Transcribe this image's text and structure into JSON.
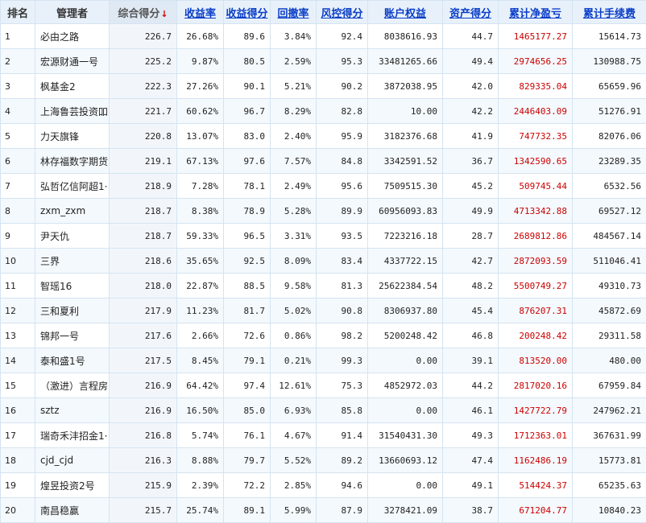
{
  "colors": {
    "accent_link": "#0b3ec8",
    "loss_red": "#cc0000",
    "sort_arrow": "#d40000"
  },
  "columns": {
    "rank": "排名",
    "manager": "管理者",
    "composite": "综合得分",
    "sort_arrow": "↓",
    "return_rate": "收益率",
    "return_score": "收益得分",
    "drawdown": "回撤率",
    "risk_score": "风控得分",
    "equity": "账户权益",
    "asset_score": "资产得分",
    "net_pnl": "累计净盈亏",
    "fees": "累计手续费"
  },
  "rows": [
    {
      "rank": "1",
      "manager": "必由之路",
      "composite": "226.7",
      "return_rate": "26.68%",
      "return_score": "89.6",
      "drawdown": "3.84%",
      "risk_score": "92.4",
      "equity": "8038616.93",
      "asset_score": "44.7",
      "net_pnl": "1465177.27",
      "fees": "15614.73"
    },
    {
      "rank": "2",
      "manager": "宏源财通一号",
      "composite": "225.2",
      "return_rate": "9.87%",
      "return_score": "80.5",
      "drawdown": "2.59%",
      "risk_score": "95.3",
      "equity": "33481265.66",
      "asset_score": "49.4",
      "net_pnl": "2974656.25",
      "fees": "130988.75"
    },
    {
      "rank": "3",
      "manager": "枫基金2",
      "composite": "222.3",
      "return_rate": "27.26%",
      "return_score": "90.1",
      "drawdown": "5.21%",
      "risk_score": "90.2",
      "equity": "3872038.95",
      "asset_score": "42.0",
      "net_pnl": "829335.04",
      "fees": "65659.96"
    },
    {
      "rank": "4",
      "manager": "上海鲁芸投资吅",
      "composite": "221.7",
      "return_rate": "60.62%",
      "return_score": "96.7",
      "drawdown": "8.29%",
      "risk_score": "82.8",
      "equity": "10.00",
      "asset_score": "42.2",
      "net_pnl": "2446403.09",
      "fees": "51276.91"
    },
    {
      "rank": "5",
      "manager": "力天旗锋",
      "composite": "220.8",
      "return_rate": "13.07%",
      "return_score": "83.0",
      "drawdown": "2.40%",
      "risk_score": "95.9",
      "equity": "3182376.68",
      "asset_score": "41.9",
      "net_pnl": "747732.35",
      "fees": "82076.06"
    },
    {
      "rank": "6",
      "manager": "林存福数字期货",
      "composite": "219.1",
      "return_rate": "67.13%",
      "return_score": "97.6",
      "drawdown": "7.57%",
      "risk_score": "84.8",
      "equity": "3342591.52",
      "asset_score": "36.7",
      "net_pnl": "1342590.65",
      "fees": "23289.35"
    },
    {
      "rank": "7",
      "manager": "弘哲亿信阿超1·",
      "composite": "218.9",
      "return_rate": "7.28%",
      "return_score": "78.1",
      "drawdown": "2.49%",
      "risk_score": "95.6",
      "equity": "7509515.30",
      "asset_score": "45.2",
      "net_pnl": "509745.44",
      "fees": "6532.56"
    },
    {
      "rank": "8",
      "manager": "zxm_zxm",
      "composite": "218.7",
      "return_rate": "8.38%",
      "return_score": "78.9",
      "drawdown": "5.28%",
      "risk_score": "89.9",
      "equity": "60956093.83",
      "asset_score": "49.9",
      "net_pnl": "4713342.88",
      "fees": "69527.12"
    },
    {
      "rank": "9",
      "manager": "尹天仇",
      "composite": "218.7",
      "return_rate": "59.33%",
      "return_score": "96.5",
      "drawdown": "3.31%",
      "risk_score": "93.5",
      "equity": "7223216.18",
      "asset_score": "28.7",
      "net_pnl": "2689812.86",
      "fees": "484567.14"
    },
    {
      "rank": "10",
      "manager": "三界",
      "composite": "218.6",
      "return_rate": "35.65%",
      "return_score": "92.5",
      "drawdown": "8.09%",
      "risk_score": "83.4",
      "equity": "4337722.15",
      "asset_score": "42.7",
      "net_pnl": "2872093.59",
      "fees": "511046.41"
    },
    {
      "rank": "11",
      "manager": "智瑶16",
      "composite": "218.0",
      "return_rate": "22.87%",
      "return_score": "88.5",
      "drawdown": "9.58%",
      "risk_score": "81.3",
      "equity": "25622384.54",
      "asset_score": "48.2",
      "net_pnl": "5500749.27",
      "fees": "49310.73"
    },
    {
      "rank": "12",
      "manager": "三和夏利",
      "composite": "217.9",
      "return_rate": "11.23%",
      "return_score": "81.7",
      "drawdown": "5.02%",
      "risk_score": "90.8",
      "equity": "8306937.80",
      "asset_score": "45.4",
      "net_pnl": "876207.31",
      "fees": "45872.69"
    },
    {
      "rank": "13",
      "manager": "锦邦一号",
      "composite": "217.6",
      "return_rate": "2.66%",
      "return_score": "72.6",
      "drawdown": "0.86%",
      "risk_score": "98.2",
      "equity": "5200248.42",
      "asset_score": "46.8",
      "net_pnl": "200248.42",
      "fees": "29311.58"
    },
    {
      "rank": "14",
      "manager": "泰和盛1号",
      "composite": "217.5",
      "return_rate": "8.45%",
      "return_score": "79.1",
      "drawdown": "0.21%",
      "risk_score": "99.3",
      "equity": "0.00",
      "asset_score": "39.1",
      "net_pnl": "813520.00",
      "fees": "480.00"
    },
    {
      "rank": "15",
      "manager": "（激进）言程房",
      "composite": "216.9",
      "return_rate": "64.42%",
      "return_score": "97.4",
      "drawdown": "12.61%",
      "risk_score": "75.3",
      "equity": "4852972.03",
      "asset_score": "44.2",
      "net_pnl": "2817020.16",
      "fees": "67959.84"
    },
    {
      "rank": "16",
      "manager": "sztz",
      "composite": "216.9",
      "return_rate": "16.50%",
      "return_score": "85.0",
      "drawdown": "6.93%",
      "risk_score": "85.8",
      "equity": "0.00",
      "asset_score": "46.1",
      "net_pnl": "1427722.79",
      "fees": "247962.21"
    },
    {
      "rank": "17",
      "manager": "瑞奇禾沣招金1·",
      "composite": "216.8",
      "return_rate": "5.74%",
      "return_score": "76.1",
      "drawdown": "4.67%",
      "risk_score": "91.4",
      "equity": "31540431.30",
      "asset_score": "49.3",
      "net_pnl": "1712363.01",
      "fees": "367631.99"
    },
    {
      "rank": "18",
      "manager": "cjd_cjd",
      "composite": "216.3",
      "return_rate": "8.88%",
      "return_score": "79.7",
      "drawdown": "5.52%",
      "risk_score": "89.2",
      "equity": "13660693.12",
      "asset_score": "47.4",
      "net_pnl": "1162486.19",
      "fees": "15773.81"
    },
    {
      "rank": "19",
      "manager": "煌昱投资2号",
      "composite": "215.9",
      "return_rate": "2.39%",
      "return_score": "72.2",
      "drawdown": "2.85%",
      "risk_score": "94.6",
      "equity": "0.00",
      "asset_score": "49.1",
      "net_pnl": "514424.37",
      "fees": "65235.63"
    },
    {
      "rank": "20",
      "manager": "南昌稳赢",
      "composite": "215.7",
      "return_rate": "25.74%",
      "return_score": "89.1",
      "drawdown": "5.99%",
      "risk_score": "87.9",
      "equity": "3278421.09",
      "asset_score": "38.7",
      "net_pnl": "671204.77",
      "fees": "10840.23"
    }
  ]
}
